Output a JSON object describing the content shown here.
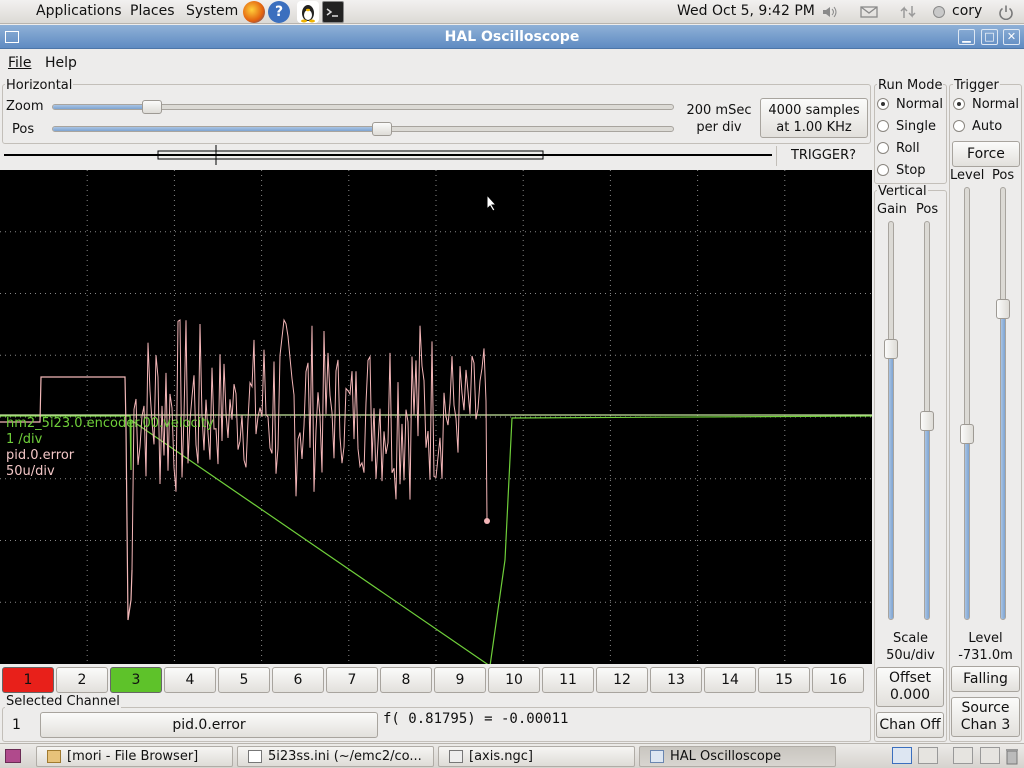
{
  "top_panel": {
    "menus": [
      "Applications",
      "Places",
      "System"
    ],
    "launchers": [
      "firefox-icon",
      "help-icon",
      "tux-icon",
      "terminal-icon"
    ],
    "clock": "Wed Oct  5,  9:42 PM",
    "user": "cory"
  },
  "window": {
    "title": "HAL Oscilloscope"
  },
  "menubar": {
    "file": "File",
    "help": "Help"
  },
  "horizontal": {
    "label": "Horizontal",
    "zoom_label": "Zoom",
    "pos_label": "Pos",
    "zoom_level": 0.16,
    "pos_level": 0.53,
    "rate_line1": "200 mSec",
    "rate_line2": "per div",
    "samples_line1": "4000 samples",
    "samples_line2": "at 1.00 KHz",
    "trigger_status": "TRIGGER?"
  },
  "scope_labels": {
    "ch3_name": "hm2_5i23.0.encoder.00.velocity",
    "ch3_scale": "1 /div",
    "ch1_name": "pid.0.error",
    "ch1_scale": "50u/div"
  },
  "run_mode": {
    "label": "Run Mode",
    "options": [
      "Normal",
      "Single",
      "Roll",
      "Stop"
    ],
    "selected": "Normal"
  },
  "trigger": {
    "label": "Trigger",
    "options": [
      "Normal",
      "Auto"
    ],
    "selected": "Normal",
    "force_label": "Force",
    "level_label": "Level",
    "pos_label": "Pos",
    "level_value_label": "Level",
    "level_value": "-731.0m",
    "edge_label": "Falling",
    "source_line1": "Source",
    "source_line2": "Chan  3"
  },
  "vertical": {
    "label": "Vertical",
    "gain_label": "Gain",
    "pos_label": "Pos",
    "scale_label": "Scale",
    "scale_value": "50u/div",
    "offset_label": "Offset",
    "offset_value": "0.000",
    "chan_off_label": "Chan Off"
  },
  "channels": [
    "1",
    "2",
    "3",
    "4",
    "5",
    "6",
    "7",
    "8",
    "9",
    "10",
    "11",
    "12",
    "13",
    "14",
    "15",
    "16"
  ],
  "channel_colors": {
    "1": "#e8201a",
    "3": "#5ec22a"
  },
  "selected_channel": {
    "label": "Selected Channel",
    "number": "1",
    "name": "pid.0.error",
    "readout": "f( 0.81795) = -0.00011"
  },
  "taskbar": {
    "items": [
      "[mori - File Browser]",
      "5i23ss.ini (~/emc2/co...",
      "[axis.ngc]",
      "HAL Oscilloscope"
    ]
  }
}
